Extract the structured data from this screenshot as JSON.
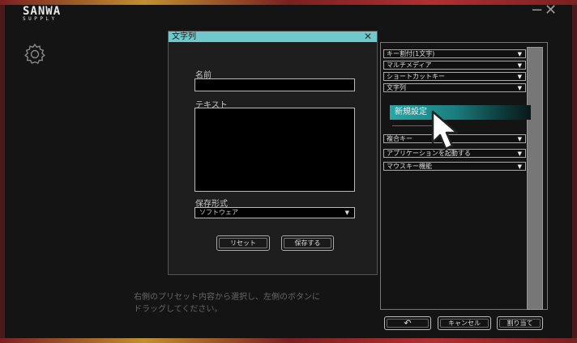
{
  "app": {
    "logo_main": "SANWA",
    "logo_sub": "SUPPLY",
    "minimize_glyph": "−",
    "close_glyph": "✕"
  },
  "dialog": {
    "title": "文字列",
    "close_glyph": "✕",
    "name_label": "名前",
    "name_value": "",
    "text_label": "テキスト",
    "text_value": "",
    "format_label": "保存形式",
    "format_value": "ソフトウェア",
    "reset_label": "リセット",
    "save_label": "保存する"
  },
  "hint": {
    "line1": "右側のプリセット内容から選択し、左側のボタンに",
    "line2": "ドラッグしてください。"
  },
  "presets": {
    "items": [
      {
        "label": "キー割付(1文字)"
      },
      {
        "label": "マルチメディア"
      },
      {
        "label": "ショートカットキー"
      },
      {
        "label": "文字列"
      },
      {
        "label": "複合キー"
      },
      {
        "label": "アプリケーションを起動する"
      },
      {
        "label": "マウスキー機能"
      }
    ],
    "expanded_child": "新規設定",
    "arrow_glyph": "▼"
  },
  "footer": {
    "undo_glyph": "↶",
    "cancel_label": "キャンセル",
    "assign_label": "割り当て"
  },
  "colors": {
    "accent": "#6ec8cc",
    "highlight": "#2aa6a6",
    "background": "#141414"
  },
  "icons": {
    "settings": "gear-icon",
    "pointer": "mouse-cursor-icon",
    "undo": "undo-icon"
  }
}
